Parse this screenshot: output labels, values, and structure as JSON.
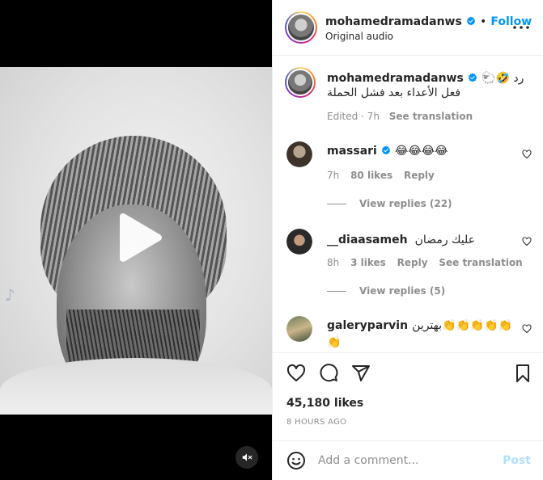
{
  "post": {
    "author": "mohamedramadanws",
    "follow_label": "Follow",
    "separator": "•",
    "audio": "Original audio",
    "caption": {
      "author": "mohamedramadanws",
      "line1": "رد 🤣🐑",
      "line2": "فعل الأعداء بعد فشل الحملة",
      "edited": "Edited · 7h",
      "see_translation": "See translation"
    },
    "comments": [
      {
        "user": "massari",
        "verified": true,
        "text": "😂😂😂😂",
        "age": "7h",
        "likes": "80 likes",
        "reply": "Reply",
        "view_replies": "View replies (22)"
      },
      {
        "user": "__diaasameh",
        "verified": false,
        "text": "عليك رمضان",
        "age": "8h",
        "likes": "3 likes",
        "reply": "Reply",
        "see_translation": "See translation",
        "view_replies": "View replies (5)"
      },
      {
        "user": "galeryparvin",
        "verified": false,
        "text": "بهترین👏👏👏👏👏👏"
      }
    ],
    "likes_count": "45,180 likes",
    "timestamp": "8 HOURS AGO",
    "add_comment_placeholder": "Add a comment...",
    "post_label": "Post"
  },
  "video": {
    "watermark": "♪"
  },
  "colors": {
    "accent": "#0095f6",
    "post_disabled": "#b2dffc",
    "muted": "#8e8e8e",
    "text": "#262626"
  },
  "icons": [
    "more-icon",
    "verified-badge-icon",
    "heart-icon",
    "comment-icon",
    "share-icon",
    "bookmark-icon",
    "emoji-icon",
    "play-icon",
    "mute-icon"
  ]
}
